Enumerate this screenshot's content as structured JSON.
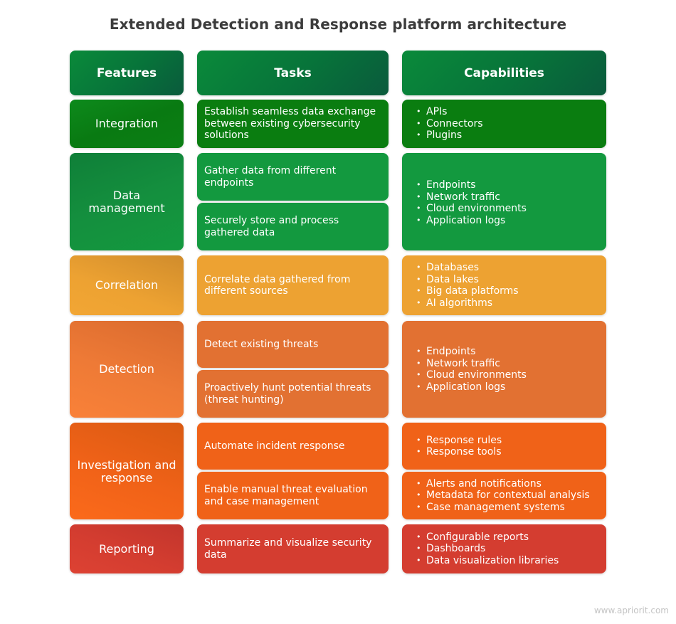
{
  "title": "Extended Detection and Response platform architecture",
  "headers": {
    "features": "Features",
    "tasks": "Tasks",
    "capabilities": "Capabilities"
  },
  "rows": [
    {
      "feature": "Integration",
      "color": "#0a7d10",
      "tasks": [
        "Establish seamless data exchange between existing cybersecurity solutions"
      ],
      "capabilities": [
        [
          "APIs",
          "Connectors",
          "Plugins"
        ]
      ]
    },
    {
      "feature": "Data management",
      "color": "#13993f",
      "tasks": [
        "Gather data from different endpoints",
        "Securely store and process gathered data"
      ],
      "capabilities": [
        [
          "Endpoints",
          "Network traffic",
          "Cloud environments",
          "Application logs"
        ]
      ]
    },
    {
      "feature": "Correlation",
      "color": "#eda232",
      "tasks": [
        "Correlate data gathered from different sources"
      ],
      "capabilities": [
        [
          "Databases",
          "Data lakes",
          "Big data platforms",
          "AI algorithms"
        ]
      ]
    },
    {
      "feature": "Detection",
      "color": "#e27132",
      "tasks": [
        "Detect existing threats",
        "Proactively hunt potential threats (threat hunting)"
      ],
      "capabilities": [
        [
          "Endpoints",
          "Network traffic",
          "Cloud environments",
          "Application logs"
        ]
      ]
    },
    {
      "feature": "Investigation and response",
      "color": "#f06218",
      "tasks": [
        "Automate incident response",
        "Enable manual threat evaluation and case management"
      ],
      "capabilities": [
        [
          "Response rules",
          "Response tools"
        ],
        [
          "Alerts and notifications",
          "Metadata for contextual analysis",
          "Case management systems"
        ]
      ]
    },
    {
      "feature": "Reporting",
      "color": "#d43d30",
      "tasks": [
        "Summarize and visualize security data"
      ],
      "capabilities": [
        [
          "Configurable reports",
          "Dashboards",
          "Data visualization libraries"
        ]
      ]
    }
  ],
  "footer": "www.apriorit.com"
}
